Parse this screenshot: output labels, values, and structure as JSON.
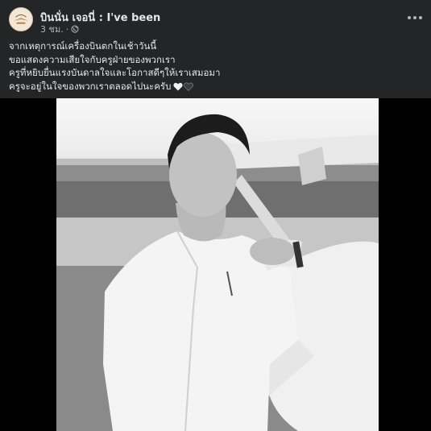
{
  "post": {
    "page_name": "บินนั่น เจอนี่ : I've been",
    "time": "3 ชม.",
    "privacy_icon": "globe-icon",
    "more_icon": "more-options-icon",
    "caption_lines": [
      "จากเหตุการณ์เครื่องบินตกในเช้าวันนี้",
      "ขอแสดงความเสียใจกับครูฝ่ายของพวกเรา",
      "ครูที่หยิบยื่นแรงบันดาลใจและโอกาสดีๆให้เราเสมอมา",
      "ครูจะอยู่ในใจของพวกเราตลอดไปนะครับ"
    ],
    "caption_emoji": [
      "white-heart-icon",
      "black-heart-icon"
    ]
  },
  "colors": {
    "background": "#242526",
    "text_primary": "#e4e6eb",
    "text_secondary": "#b0b3b8",
    "media_background": "#000000"
  }
}
